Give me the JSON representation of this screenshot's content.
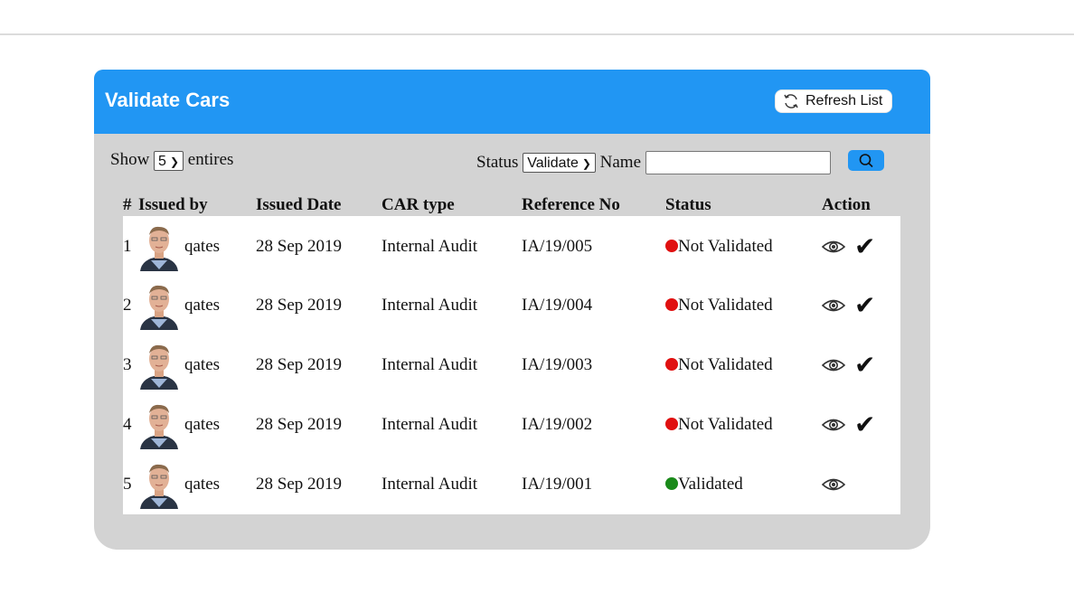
{
  "panel": {
    "title": "Validate Cars",
    "refresh_label": "Refresh List"
  },
  "controls": {
    "show_label": "Show",
    "show_value": "5",
    "entries_label": "entires",
    "status_label": "Status",
    "status_value": "Validate",
    "name_label": "Name",
    "name_value": ""
  },
  "table": {
    "headers": [
      "#",
      "Issued by",
      "Issued Date",
      "CAR type",
      "Reference No",
      "Status",
      "Action"
    ],
    "rows": [
      {
        "num": "1",
        "issued_by": "qates",
        "date": "28 Sep 2019",
        "car_type": "Internal Audit",
        "ref": "IA/19/005",
        "status": "Not Validated",
        "status_color": "#e01010",
        "can_validate": true
      },
      {
        "num": "2",
        "issued_by": "qates",
        "date": "28 Sep 2019",
        "car_type": "Internal Audit",
        "ref": "IA/19/004",
        "status": "Not Validated",
        "status_color": "#e01010",
        "can_validate": true
      },
      {
        "num": "3",
        "issued_by": "qates",
        "date": "28 Sep 2019",
        "car_type": "Internal Audit",
        "ref": "IA/19/003",
        "status": "Not Validated",
        "status_color": "#e01010",
        "can_validate": true
      },
      {
        "num": "4",
        "issued_by": "qates",
        "date": "28 Sep 2019",
        "car_type": "Internal Audit",
        "ref": "IA/19/002",
        "status": "Not Validated",
        "status_color": "#e01010",
        "can_validate": true
      },
      {
        "num": "5",
        "issued_by": "qates",
        "date": "28 Sep 2019",
        "car_type": "Internal Audit",
        "ref": "IA/19/001",
        "status": "Validated",
        "status_color": "#1a8a1a",
        "can_validate": false
      }
    ]
  },
  "colors": {
    "header_blue": "#2196f3",
    "panel_gray": "#d3d3d3"
  },
  "icons": {
    "refresh": "refresh-icon",
    "search": "search-icon",
    "view": "eye-icon",
    "validate": "check-icon"
  }
}
